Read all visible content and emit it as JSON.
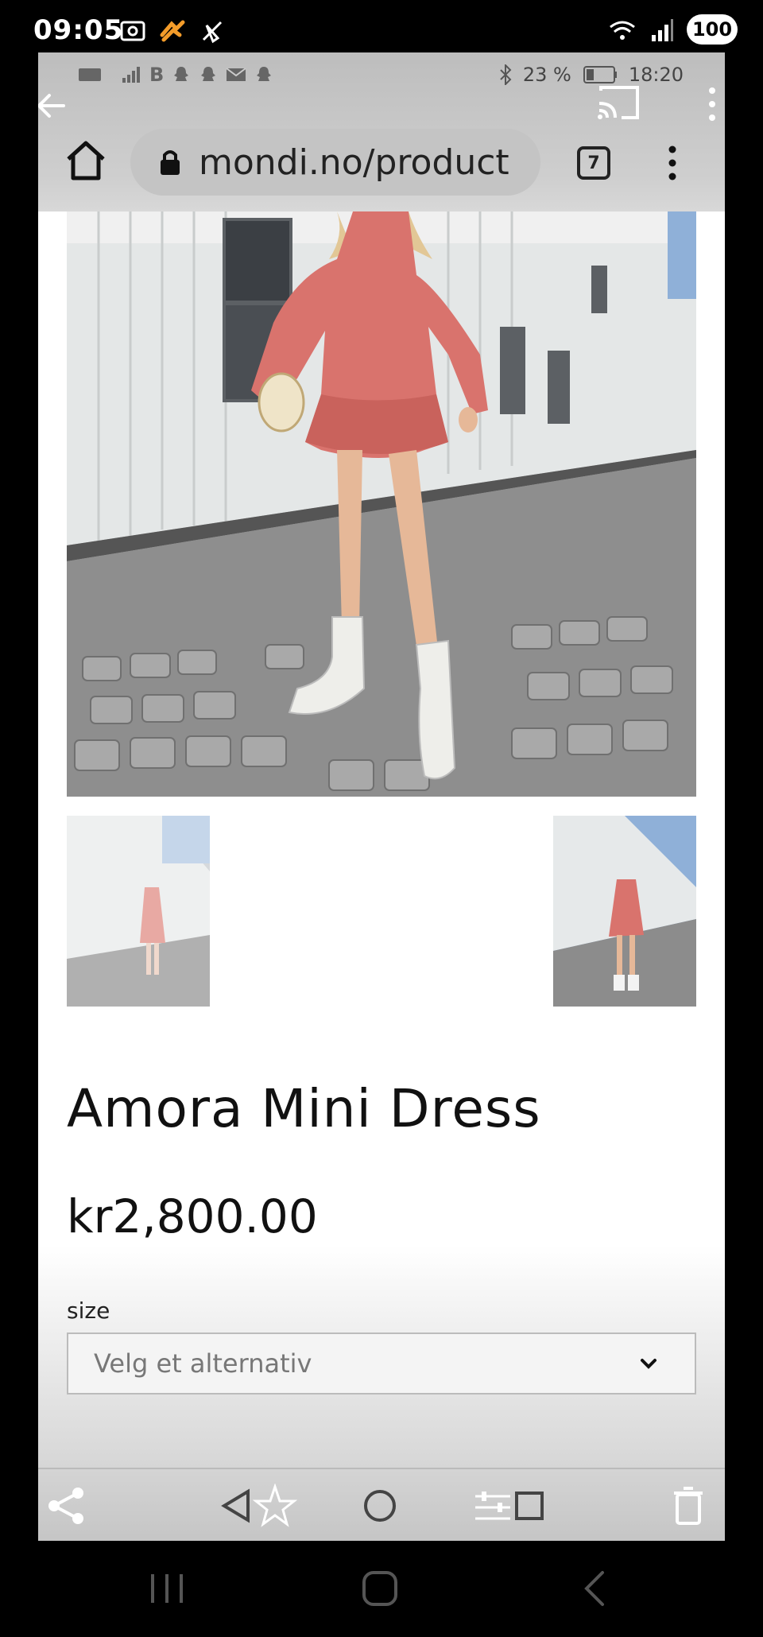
{
  "status_bar": {
    "time": "09:05",
    "battery": "100"
  },
  "inner_status": {
    "battery_percent": "23 %",
    "time": "18:20"
  },
  "browser": {
    "url": "mondi.no/product",
    "tab_count": "7"
  },
  "product": {
    "title": "Amora Mini Dress",
    "price": "kr2,800.00",
    "size_label": "size",
    "size_placeholder": "Velg et alternativ"
  },
  "colors": {
    "dress": "#d9736d",
    "wall": "#e8eaea",
    "cobblestone": "#8f8f8f",
    "boots": "#eeeeea",
    "sky": "#8fb0d8"
  }
}
